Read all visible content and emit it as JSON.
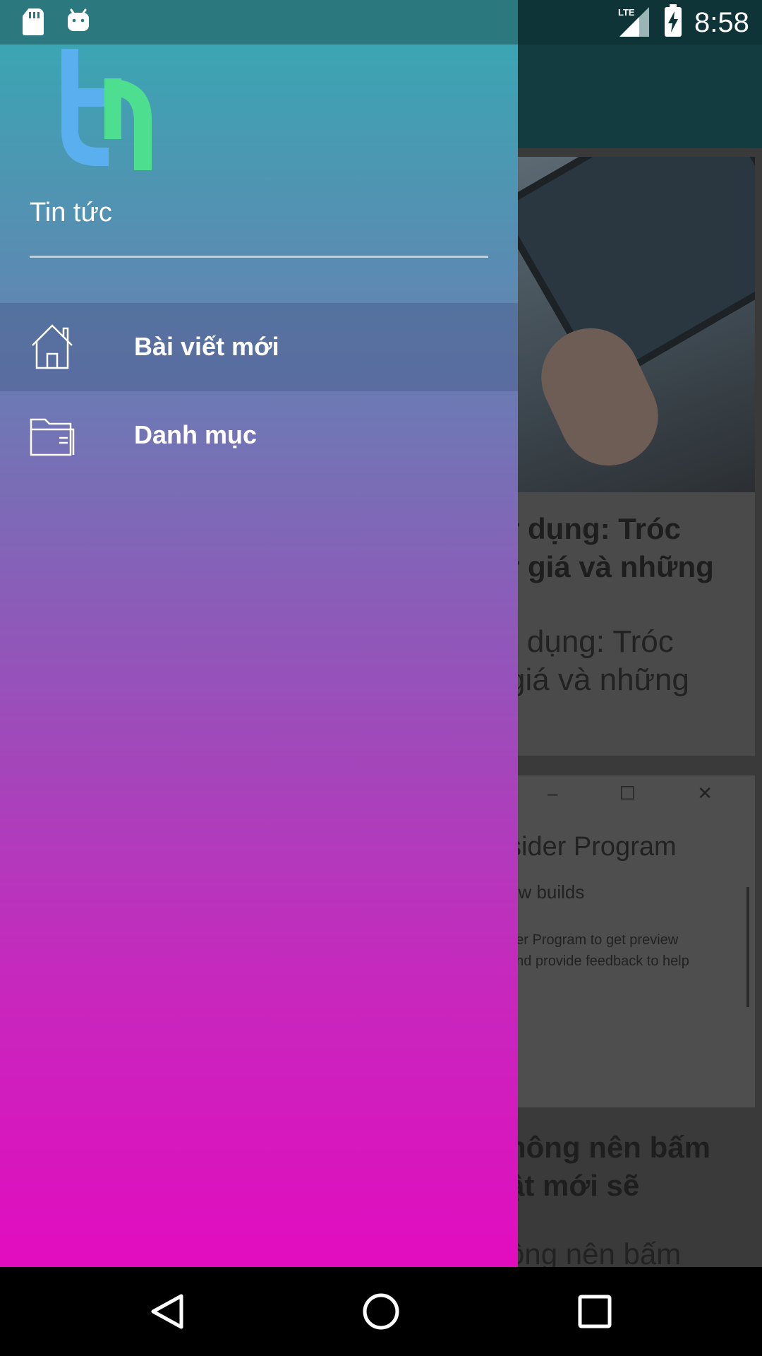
{
  "status_bar": {
    "time": "8:58",
    "network": "LTE",
    "icons": [
      "sd-card-icon",
      "android-icon",
      "lte-signal-icon",
      "battery-charging-icon"
    ]
  },
  "drawer": {
    "logo": "th",
    "title": "Tin tức",
    "items": [
      {
        "label": "Bài viết mới",
        "icon": "home-icon",
        "active": true
      },
      {
        "label": "Danh mục",
        "icon": "folder-icon",
        "active": false
      }
    ],
    "colors": {
      "gradient_top": "#3ba5b3",
      "gradient_mid": "#8f58b9",
      "gradient_bottom": "#e20cbf",
      "logo_blue": "#5ab0ee",
      "logo_green": "#4ede90"
    }
  },
  "background": {
    "card1": {
      "title_lines": [
        "r dụng: Tróc",
        "r giá và những"
      ],
      "desc_lines": [
        "r dụng: Tróc",
        "giá và những"
      ]
    },
    "card2": {
      "window_controls": "– ☐ ✕",
      "heading": "sider Program",
      "subheading": "ew builds",
      "text_lines": [
        "der Program to get preview",
        "and provide feedback to help"
      ]
    },
    "card3": {
      "title_lines": [
        "hông nên bấm",
        "ật mới sẽ"
      ],
      "desc_line": "ông nên bấm"
    }
  },
  "navigation_bar": {
    "buttons": [
      "back-button",
      "home-button",
      "recents-button"
    ]
  }
}
